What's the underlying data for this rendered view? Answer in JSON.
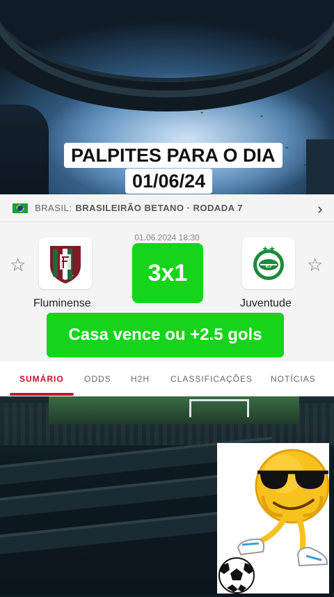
{
  "overlay": {
    "title_line1": "PALPITES PARA O DIA",
    "title_line2": "01/06/24"
  },
  "league": {
    "flag": "brazil-flag",
    "country": "BRASIL:",
    "name": "BRASILEIRÃO BETANO · RODADA 7",
    "chevron": "›"
  },
  "match": {
    "datetime": "01.06.2024 18:30",
    "home_team": "Fluminense",
    "away_team": "Juventude",
    "score": "3x1",
    "tip": "Casa vence ou +2.5 gols",
    "star_icon": "☆"
  },
  "tabs": [
    {
      "label": "SUMÁRIO",
      "active": true
    },
    {
      "label": "ODDS",
      "active": false
    },
    {
      "label": "H2H",
      "active": false
    },
    {
      "label": "CLASSIFICAÇÕES",
      "active": false
    },
    {
      "label": "NOTÍCIAS",
      "active": false
    }
  ],
  "colors": {
    "accent_green": "#16d41a",
    "tab_active": "#c8102e"
  },
  "sticker": "sunglasses-emoji-football"
}
